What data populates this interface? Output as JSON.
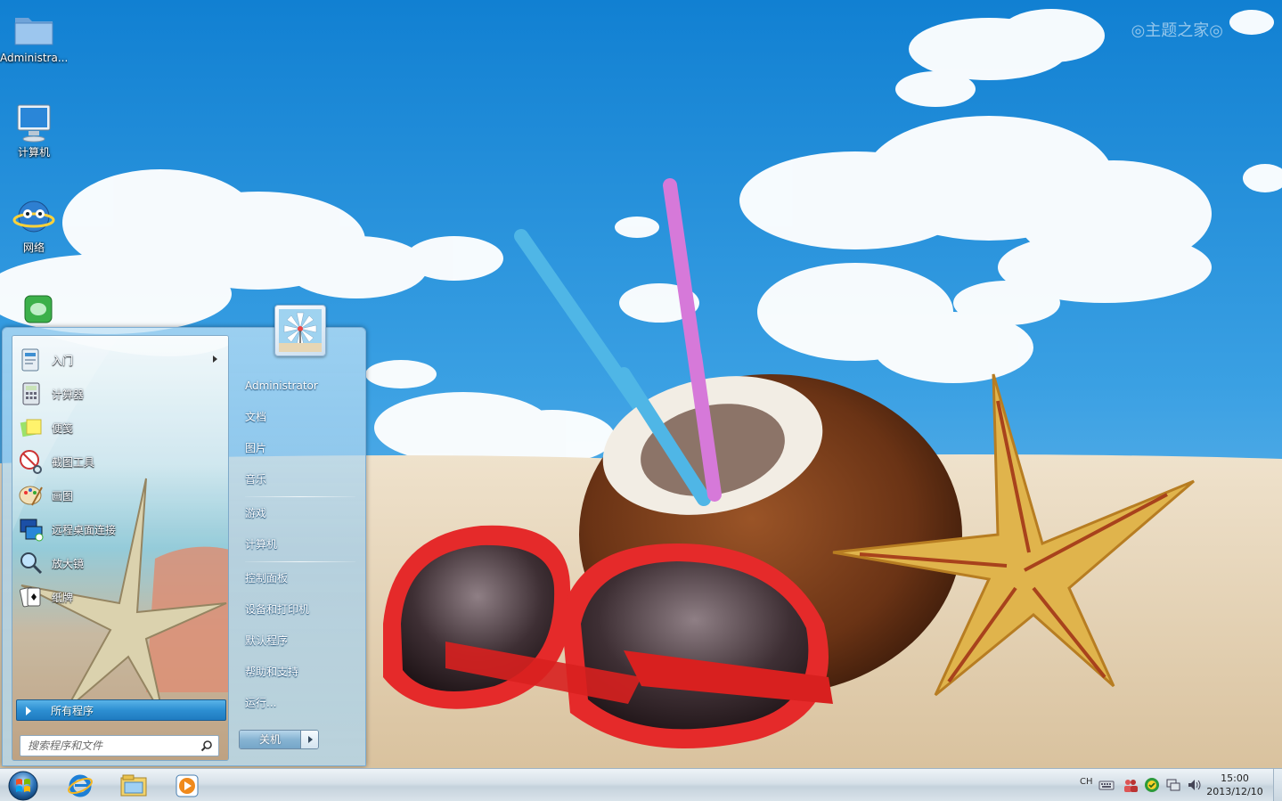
{
  "desktop": {
    "icons": [
      {
        "label": "Administra..."
      },
      {
        "label": "计算机"
      },
      {
        "label": "网络"
      }
    ],
    "watermark": "◎主题之家◎"
  },
  "start_menu": {
    "programs": [
      {
        "label": "入门",
        "icon": "getting-started-icon",
        "has_submenu": true
      },
      {
        "label": "计算器",
        "icon": "calculator-icon"
      },
      {
        "label": "便笺",
        "icon": "sticky-notes-icon"
      },
      {
        "label": "截图工具",
        "icon": "snipping-tool-icon"
      },
      {
        "label": "画图",
        "icon": "paint-icon"
      },
      {
        "label": "远程桌面连接",
        "icon": "remote-desktop-icon"
      },
      {
        "label": "放大镜",
        "icon": "magnifier-icon"
      },
      {
        "label": "纸牌",
        "icon": "solitaire-icon"
      }
    ],
    "all_programs": "所有程序",
    "search_placeholder": "搜索程序和文件",
    "right_items": [
      {
        "label": "Administrator"
      },
      {
        "label": "文档"
      },
      {
        "label": "图片"
      },
      {
        "label": "音乐"
      },
      {
        "label": "游戏"
      },
      {
        "label": "计算机"
      },
      {
        "label": "控制面板"
      },
      {
        "label": "设备和打印机"
      },
      {
        "label": "默认程序"
      },
      {
        "label": "帮助和支持"
      },
      {
        "label": "运行..."
      }
    ],
    "shutdown": "关机"
  },
  "taskbar": {
    "apps": [
      "ie-icon",
      "explorer-icon",
      "media-player-icon"
    ],
    "ime": "CH",
    "clock_time": "15:00",
    "clock_date": "2013/12/10"
  }
}
